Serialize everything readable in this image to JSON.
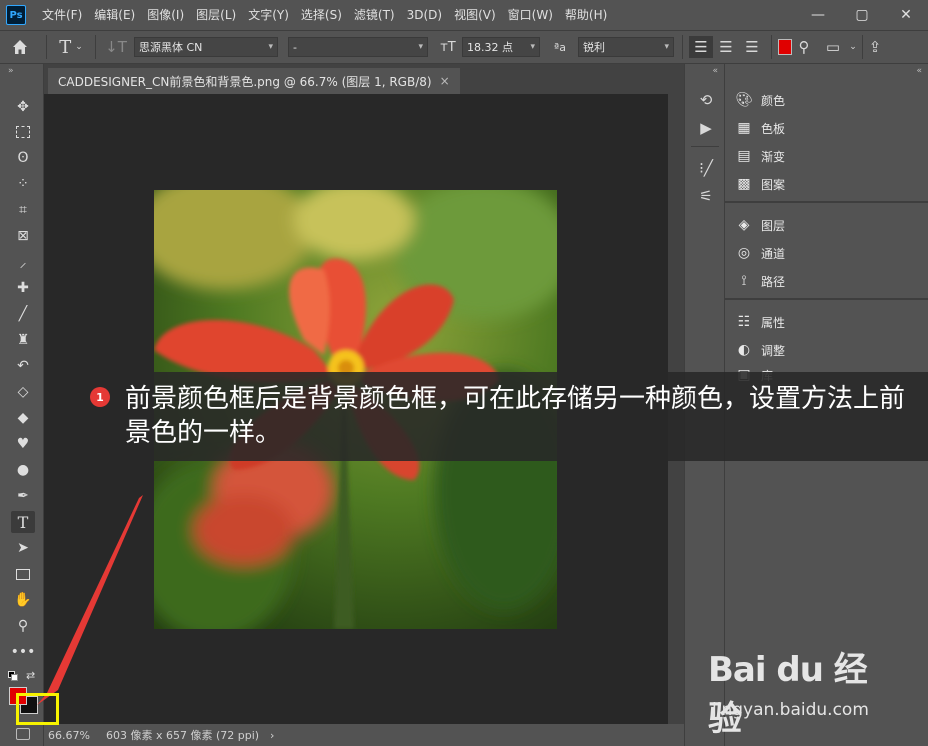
{
  "app": {
    "logo": "Ps"
  },
  "menu": [
    "文件(F)",
    "编辑(E)",
    "图像(I)",
    "图层(L)",
    "文字(Y)",
    "选择(S)",
    "滤镜(T)",
    "3D(D)",
    "视图(V)",
    "窗口(W)",
    "帮助(H)"
  ],
  "window_controls": {
    "minimize": "—",
    "maximize": "▢",
    "close": "✕"
  },
  "options": {
    "font_family": "思源黑体 CN",
    "font_style": "-",
    "font_size": "18.32 点",
    "aa_label": "ªa",
    "antialias": "锐利",
    "text_color": "#e00000"
  },
  "document": {
    "tab_title": "CADDESIGNER_CN前景色和背景色.png @ 66.7% (图层 1, RGB/8)",
    "close": "×"
  },
  "status": {
    "zoom": "66.67%",
    "doc_info": "603 像素 x 657 像素 (72 ppi)",
    "arrow": "›"
  },
  "colors": {
    "foreground": "#e00000",
    "background": "#101010",
    "highlight": "#f7f300",
    "arrow": "#e53935"
  },
  "panels": {
    "group1": [
      "颜色",
      "色板",
      "渐变",
      "图案"
    ],
    "group2": [
      "图层",
      "通道",
      "路径"
    ],
    "group3": [
      "属性",
      "调整",
      "库"
    ]
  },
  "callout": {
    "badge": "1",
    "text": "前景颜色框后是背景颜色框，可在此存储另一种颜色，设置方法上前景色的一样。"
  },
  "watermark": {
    "brand": "Bai du 经验",
    "url": "jingyan.baidu.com"
  },
  "icons": [
    "home-icon",
    "text-tool-icon",
    "vertical-text-icon",
    "align-left-icon",
    "align-center-icon",
    "align-right-icon",
    "warp-text-icon",
    "search-icon",
    "panel-icon",
    "share-icon",
    "move-icon",
    "marquee-icon",
    "lasso-icon",
    "quick-select-icon",
    "crop-icon",
    "frame-icon",
    "eyedropper-icon",
    "healing-icon",
    "brush-icon",
    "stamp-icon",
    "history-brush-icon",
    "eraser-icon",
    "paint-bucket-icon",
    "blur-icon",
    "dodge-icon",
    "pen-icon",
    "type-icon",
    "path-select-icon",
    "rectangle-icon",
    "hand-icon",
    "zoom-icon",
    "more-icon"
  ]
}
